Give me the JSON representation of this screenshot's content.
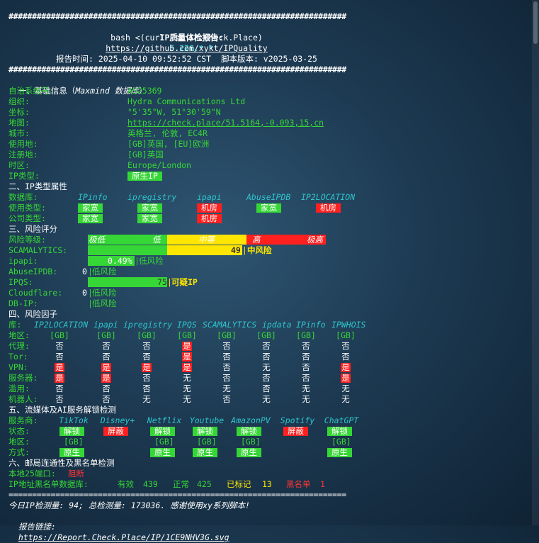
{
  "header": {
    "hash_line": "########################################################################",
    "title_label": "IP质量体检报告:",
    "title_ip": "5.226.*.*",
    "cmd": "bash <(curl -sL IP.Check.Place)",
    "github": "https://github.com/xykt/IPQuality",
    "report_time": "报告时间: 2025-04-10 09:52:52 CST  脚本版本: v2025-03-25"
  },
  "basic": {
    "title": "一、基础信息（",
    "title_db": "Maxmind 数据库",
    "title_end": "）",
    "rows": [
      {
        "label": "自治系统号:",
        "value": "AS25369"
      },
      {
        "label": "组织:",
        "value": "Hydra Communications Ltd"
      },
      {
        "label": "坐标:",
        "value": "°5'35\"W, 51°30'59\"N"
      },
      {
        "label": "地图:",
        "value": "https://check.place/51.5164,-0.093,15,cn"
      },
      {
        "label": "城市:",
        "value": "英格兰, 伦敦, EC4R"
      },
      {
        "label": "使用地:",
        "value": "[GB]英国, [EU]欧洲"
      },
      {
        "label": "注册地:",
        "value": "[GB]英国"
      },
      {
        "label": "时区:",
        "value": "Europe/London"
      },
      {
        "label": "IP类型:",
        "value": "原生IP"
      }
    ]
  },
  "type_attr": {
    "title": "二、IP类型属性",
    "db_label": "数据库:",
    "dbs": [
      "IPinfo",
      "ipregistry",
      "ipapi",
      "AbuseIPDB",
      "IP2LOCATION"
    ],
    "use_label": "使用类型:",
    "use": [
      "家宽",
      "家宽",
      "机房",
      "家宽",
      "机房"
    ],
    "company_label": "公司类型:",
    "company": [
      "家宽",
      "家宽",
      "机房"
    ]
  },
  "risk": {
    "title": "三、风险评分",
    "level_label": "风险等级:",
    "levels": [
      "极低",
      "低",
      "中等",
      "高",
      "极高"
    ],
    "scamalytics_label": "SCAMALYTICS:",
    "scamalytics_value": "49",
    "scamalytics_text": "中风险",
    "ipapi_label": "ipapi:",
    "ipapi_value": "0.49%",
    "ipapi_text": "低风险",
    "abuse_label": "AbuseIPDB:",
    "abuse_value": "0",
    "abuse_text": "低风险",
    "ipqs_label": "IPQS:",
    "ipqs_value": "75",
    "ipqs_text": "可疑IP",
    "cloudflare_label": "Cloudflare:",
    "cloudflare_value": "0",
    "cloudflare_text": "低风险",
    "dbip_label": "DB-IP:",
    "dbip_text": "低风险"
  },
  "factors": {
    "title": "四、风险因子",
    "db_label": "库:",
    "dbs": [
      "IP2LOCATION",
      "ipapi",
      "ipregistry",
      "IPQS",
      "SCAMALYTICS",
      "ipdata",
      "IPinfo",
      "IPWHOIS"
    ],
    "rows": [
      {
        "label": "地区:",
        "cells": [
          "[GB]",
          "[GB]",
          "[GB]",
          "[GB]",
          "[GB]",
          "[GB]",
          "[GB]",
          "[GB]"
        ]
      },
      {
        "label": "代理:",
        "cells": [
          "否",
          "否",
          "否",
          "是",
          "否",
          "否",
          "否",
          "否"
        ]
      },
      {
        "label": "Tor:",
        "cells": [
          "否",
          "否",
          "否",
          "是",
          "否",
          "否",
          "否",
          "否"
        ]
      },
      {
        "label": "VPN:",
        "cells": [
          "是",
          "是",
          "是",
          "是",
          "否",
          "无",
          "否",
          "是"
        ]
      },
      {
        "label": "服务器:",
        "cells": [
          "是",
          "是",
          "否",
          "无",
          "否",
          "否",
          "否",
          "是"
        ]
      },
      {
        "label": "滥用:",
        "cells": [
          "否",
          "否",
          "否",
          "无",
          "无",
          "否",
          "无",
          "无"
        ]
      },
      {
        "label": "机器人:",
        "cells": [
          "否",
          "否",
          "无",
          "无",
          "否",
          "无",
          "无",
          "无"
        ]
      }
    ]
  },
  "streaming": {
    "title": "五、流媒体及AI服务解锁检测",
    "svc_label": "服务商:",
    "services": [
      "TikTok",
      "Disney+",
      "Netflix",
      "Youtube",
      "AmazonPV",
      "Spotify",
      "ChatGPT"
    ],
    "status_label": "状态:",
    "status": [
      "解锁",
      "屏蔽",
      "解锁",
      "解锁",
      "解锁",
      "屏蔽",
      "解锁"
    ],
    "region_label": "地区:",
    "region": [
      "[GB]",
      "",
      "[GB]",
      "[GB]",
      "[GB]",
      "",
      "[GB]"
    ],
    "method_label": "方式:",
    "method": [
      "原生",
      "",
      "原生",
      "原生",
      "原生",
      "",
      "原生"
    ]
  },
  "mail": {
    "title": "六、邮局连通性及黑名单检测",
    "port_label": "本地25端口:",
    "port_value": "阻断",
    "bl_label": "IP地址黑名单数据库:",
    "valid_label": "有效",
    "valid_value": "439",
    "normal_label": "正常",
    "normal_value": "425",
    "marked_label": "已标记",
    "marked_value": "13",
    "black_label": "黑名单",
    "black_value": "1"
  },
  "footer": {
    "eq_line": "========================================================================",
    "stats": "今日IP检测量: 94; 总检测量: 173036. 感谢使用xy系列脚本!",
    "link_label": "报告链接:",
    "link": "https://Report.Check.Place/IP/1CE9NHV3G.svg"
  },
  "colors": {
    "green": "#36d636",
    "red": "#ff2020",
    "yellow": "#ffe600",
    "cyan": "#2ec4cc"
  }
}
